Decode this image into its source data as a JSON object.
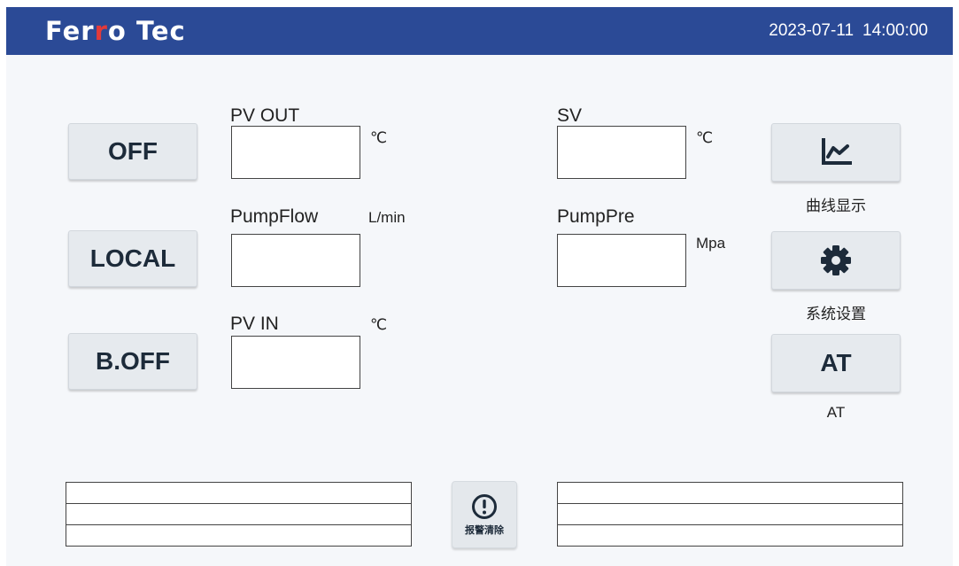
{
  "header": {
    "logo_part1": "Fer",
    "logo_part2": "r",
    "logo_part3": "o Tec",
    "date": "2023-07-11",
    "time": "14:00:00"
  },
  "left_buttons": {
    "off": "OFF",
    "local": "LOCAL",
    "boff": "B.OFF"
  },
  "readouts": {
    "pv_out": {
      "label": "PV OUT",
      "unit": "℃",
      "value": ""
    },
    "pump_flow": {
      "label": "PumpFlow",
      "unit": "L/min",
      "value": ""
    },
    "pv_in": {
      "label": "PV IN",
      "unit": "℃",
      "value": ""
    },
    "sv": {
      "label": "SV",
      "unit": "℃",
      "value": ""
    },
    "pump_pre": {
      "label": "PumpPre",
      "unit": "Mpa",
      "value": ""
    }
  },
  "right_buttons": {
    "curve_caption": "曲线显示",
    "settings_caption": "系统设置",
    "at_label": "AT",
    "at_caption": "AT"
  },
  "alarm": {
    "clear_label": "报警清除"
  },
  "colors": {
    "header_bg": "#2b4a96",
    "accent_red": "#e23a3a",
    "button_bg": "#e6eaee",
    "icon_color": "#1d2b3a"
  }
}
